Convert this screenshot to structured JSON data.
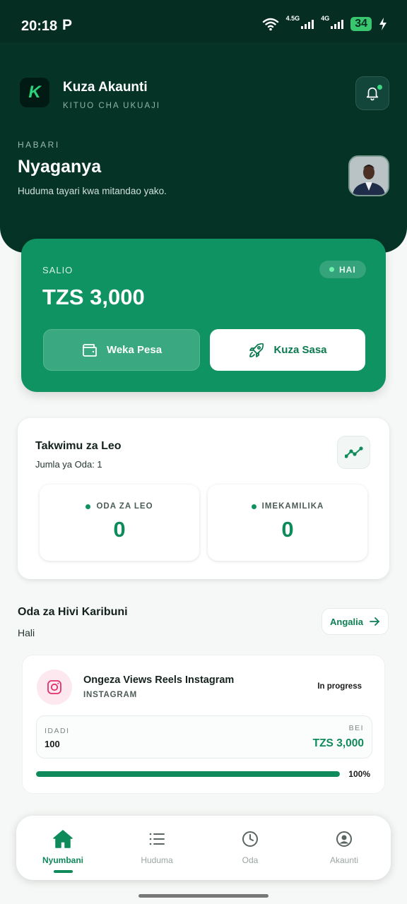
{
  "status": {
    "time": "20:18",
    "extra": "P",
    "net1": "4.5G",
    "net2": "4G",
    "battery": "34"
  },
  "app": {
    "logo_letter": "K",
    "title": "Kuza Akaunti",
    "subtitle": "KITUO CHA UKUAJI"
  },
  "greeting": {
    "label": "HABARI",
    "name": "Nyaganya",
    "subtitle": "Huduma tayari kwa mitandao yako."
  },
  "balance": {
    "label": "SALIO",
    "badge": "HAI",
    "amount": "TZS 3,000",
    "deposit_label": "Weka Pesa",
    "boost_label": "Kuza Sasa"
  },
  "stats": {
    "title": "Takwimu za Leo",
    "subtitle": "Jumla ya Oda: 1",
    "boxes": [
      {
        "label": "ODA ZA LEO",
        "value": "0"
      },
      {
        "label": "IMEKAMILIKA",
        "value": "0"
      }
    ]
  },
  "recent": {
    "title": "Oda za Hivi Karibuni",
    "subtitle": "Hali",
    "see_all": "Angalia"
  },
  "order": {
    "name": "Ongeza Views Reels Instagram",
    "platform": "INSTAGRAM",
    "status": "In progress",
    "qty_label": "IDADI",
    "qty_value": "100",
    "price_label": "BEI",
    "price_value": "TZS 3,000",
    "progress": 100,
    "progress_text": "100%"
  },
  "nav": {
    "items": [
      {
        "label": "Nyumbani",
        "icon": "home-icon"
      },
      {
        "label": "Huduma",
        "icon": "list-icon"
      },
      {
        "label": "Oda",
        "icon": "clock-icon"
      },
      {
        "label": "Akaunti",
        "icon": "user-circle-icon"
      }
    ],
    "active": "Nyumbani"
  },
  "colors": {
    "header_bg": "#053326",
    "accent": "#0f9363",
    "accent_dark": "#0f8a5b"
  }
}
